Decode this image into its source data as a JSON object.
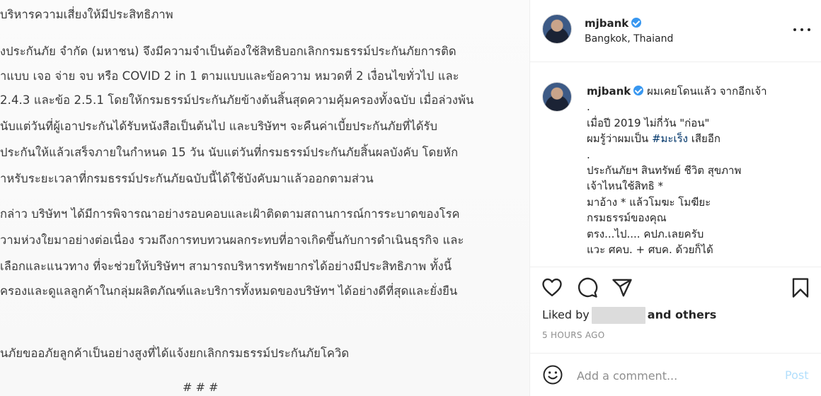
{
  "document": {
    "lines": [
      "บริหารความเสี่ยงให้มีประสิทธิภาพ",
      "งประกันภัย จำกัด (มหาชน) จึงมีความจำเป็นต้องใช้สิทธิบอกเลิกกรมธรรม์ประกันภัยการติด",
      "าแบบ เจอ จ่าย จบ หรือ COVID 2 in 1 ตามแบบและข้อความ หมวดที่ 2 เงื่อนไขทั่วไป และ",
      "2.4.3 และข้อ 2.5.1 โดยให้กรมธรรม์ประกันภัยข้างต้นสิ้นสุดความคุ้มครองทั้งฉบับ เมื่อล่วงพ้น",
      "นับแต่วันที่ผู้เอาประกันได้รับหนังสือเป็นต้นไป และบริษัทฯ จะคืนค่าเบี้ยประกันภัยที่ได้รับ",
      "ประกันให้แล้วเสร็จภายในกำหนด 15 วัน นับแต่วันที่กรมธรรม์ประกันภัยสิ้นผลบังคับ โดยหัก",
      "ำหรับระยะเวลาที่กรมธรรม์ประกันภัยฉบับนี้ได้ใช้บังคับมาแล้วออกตามส่วน",
      "กล่าว บริษัทฯ ได้มีการพิจารณาอย่างรอบคอบและเฝ้าติดตามสถานการณ์การระบาดของโรค",
      "วามห่วงใยมาอย่างต่อเนื่อง รวมถึงการทบทวนผลกระทบที่อาจเกิดขึ้นกับการดำเนินธุรกิจ และ",
      "เลือกและแนวทาง ที่จะช่วยให้บริษัทฯ สามารถบริหารทรัพยากรได้อย่างมีประสิทธิภาพ ทั้งนี้",
      "ครองและดูแลลูกค้าในกลุ่มผลิตภัณฑ์และบริการทั้งหมดของบริษัทฯ ได้อย่างดีที่สุดและยั่งยืน",
      "นภัยขออภัยลูกค้าเป็นอย่างสูงที่ได้แจ้งยกเลิกกรมธรรม์ประกันภัยโควิด"
    ],
    "end_mark": "# # #"
  },
  "header": {
    "username": "mjbank",
    "location": "Bangkok, Thaiand"
  },
  "caption": {
    "username": "mjbank",
    "first_line": "ผมเคยโดนแล้ว จากอีกเจ้า",
    "lines": [
      ".",
      "เมื่อปี 2019 ไม่กี่วัน \"ก่อน\"",
      "ผมรู้ว่าผมเป็น",
      ".",
      "ประกันภัยฯ สินทรัพย์ ชีวิต สุขภาพ",
      "เจ้าไหนใช้สิทธิ *",
      "มาอ้าง * แล้วโมฆะ โมฆียะ",
      "กรมธรรม์ของคุณ",
      "ตรง...ไป.... คปภ.เลยครับ",
      "แวะ ศคบ. + ศบค. ด้วยก็ได้"
    ],
    "hashtag": "#มะเร็ง",
    "line3_suffix": " เสียอีก"
  },
  "engagement": {
    "liked_prefix": "Liked by",
    "liked_suffix": "and others",
    "timestamp": "5 HOURS AGO"
  },
  "comment": {
    "placeholder": "Add a comment...",
    "post_label": "Post"
  },
  "colors": {
    "verified": "#3897f0",
    "hashtag": "#003569",
    "post_disabled": "#b2dffc",
    "muted": "#8e8e8e"
  }
}
